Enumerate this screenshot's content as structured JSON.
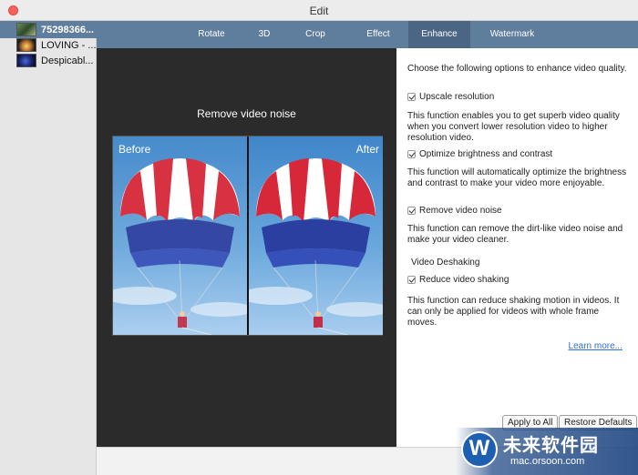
{
  "window": {
    "title": "Edit"
  },
  "files": [
    {
      "name": "75298366...",
      "selected": true,
      "thumb": "t1"
    },
    {
      "name": "LOVING - ...",
      "selected": false,
      "thumb": "t2"
    },
    {
      "name": "Despicabl...",
      "selected": false,
      "thumb": "t3"
    }
  ],
  "tabs": [
    {
      "label": "Rotate",
      "active": false
    },
    {
      "label": "3D",
      "active": false
    },
    {
      "label": "Crop",
      "active": false
    },
    {
      "label": "Effect",
      "active": false
    },
    {
      "label": "Enhance",
      "active": true
    },
    {
      "label": "Watermark",
      "active": false
    }
  ],
  "preview": {
    "title": "Remove video noise",
    "before_label": "Before",
    "after_label": "After"
  },
  "enhance": {
    "intro": "Choose the following options to enhance video quality.",
    "options": [
      {
        "label": "Upscale resolution",
        "checked": true,
        "desc": "This function enables you to get superb video quality when you convert lower resolution video to higher resolution video."
      },
      {
        "label": "Optimize brightness and contrast",
        "checked": true,
        "desc": "This function will automatically optimize the brightness and contrast to make your video more enjoyable."
      },
      {
        "label": "Remove video noise",
        "checked": true,
        "desc": "This function can remove the dirt-like video noise and make your video cleaner."
      }
    ],
    "deshake_title": "Video Deshaking",
    "deshake_option": {
      "label": "Reduce video shaking",
      "checked": true,
      "desc": "This function can reduce shaking motion in videos. It can only be applied for videos with whole frame moves."
    },
    "learn_more": "Learn more...",
    "apply_all": "Apply to All",
    "restore_defaults": "Restore Defaults"
  },
  "watermark": {
    "brand": "未来软件园",
    "url": "mac.orsoon.com"
  },
  "colors": {
    "accent": "#5f7d9c",
    "active_tab": "#4b6684",
    "link": "#2e6fcf"
  }
}
